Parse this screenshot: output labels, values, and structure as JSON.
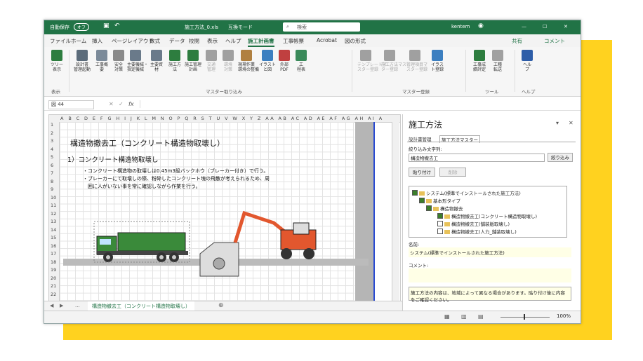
{
  "titlebar": {
    "autosave": "自動保存",
    "autosave_state": "オフ",
    "filename": "施工方法_0.xls",
    "mode": "互換モード",
    "search": "検索",
    "user": "kentem"
  },
  "tabs": [
    "ファイル",
    "ホーム",
    "挿入",
    "ページレイアウト",
    "数式",
    "データ",
    "校閲",
    "表示",
    "ヘルプ",
    "施工計画書",
    "工事帳票",
    "Acrobat",
    "図の形式"
  ],
  "active_tab": "施工計画書",
  "share": {
    "share_label": "共有",
    "comment_label": "コメント"
  },
  "ribbon": {
    "buttons": [
      {
        "label": "ツリー\n表示"
      },
      {
        "label": "設計書\n管理起動"
      },
      {
        "label": "工事概\n要"
      },
      {
        "label": "安全\n対策"
      },
      {
        "label": "主要機械・\n指定機械"
      },
      {
        "label": "主要資\n材"
      },
      {
        "label": "施工方\n法"
      },
      {
        "label": "施工管理\n計画"
      },
      {
        "label": "交通\n管理"
      },
      {
        "label": "環境\n対策"
      },
      {
        "label": "現場作業\n環境の整備"
      },
      {
        "label": "イラスト\nと図"
      },
      {
        "label": "外部\nPDF"
      },
      {
        "label": "工\n程表"
      },
      {
        "label": "テンプレートマ\nスター登録"
      },
      {
        "label": "施工方法マス\nター登録"
      },
      {
        "label": "管理項目マ\nスター登録"
      },
      {
        "label": "イラス\nト登録"
      },
      {
        "label": "工事成\n績評定"
      },
      {
        "label": "工種\n転送"
      },
      {
        "label": "ヘル\nプ"
      }
    ],
    "groups": {
      "display": "表示",
      "master_import": "マスター取り込み",
      "master_register": "マスター登録",
      "tools": "ツール",
      "help": "ヘルプ"
    }
  },
  "formula": {
    "namebox": "図 44",
    "fx": "fx"
  },
  "sheet": {
    "columns": "A B C D E F G H I J K L M N O P Q R S T U V W X Y Z AA AB AC AD AE AF AG AH AI A",
    "rows": [
      "1",
      "2",
      "3",
      "4",
      "5",
      "6",
      "7",
      "8",
      "9",
      "10",
      "11",
      "12",
      "13",
      "14",
      "15",
      "16",
      "17",
      "18",
      "19",
      "20",
      "21",
      "22"
    ],
    "title": "構造物撤去工（コンクリート構造物取壊し）",
    "subtitle": "1）コンクリート構造物取壊し",
    "line1": "・コンクリート構造物の取壊しは0.45m3級バックホウ（ブレーカー付き）で行う。",
    "line2": "・ブレーカーにて取壊しの際、粉砕したコンクリート塊の飛散が考えられるため、周",
    "line3": "　囲に人がいない事を常に確認しながら作業を行う。"
  },
  "sheet_tab": "構造物撤去工（コンクリート構造物取壊し）",
  "sheet_nav": "...",
  "pane": {
    "title": "施工方法",
    "tab1": "設計書管理",
    "tab2": "施工方法マスター",
    "filter_label": "絞り込み文字列:",
    "filter_value": "構造物撤去工",
    "filter_btn": "絞り込み",
    "paste_btn": "貼り付け",
    "delete_btn": "削除",
    "tree": [
      "システム(標準でインストールされた施工方法)",
      "基本形タイプ",
      "構造物撤去",
      "構造物撤去工(コンクリート構造物取壊し)",
      "構造物撤去工(舗装版取壊し)",
      "構造物撤去工(人力_舗装取壊し)"
    ],
    "name_label": "名前:",
    "name_value": "システム(標準でインストールされた施工方法)",
    "comment_label": "コメント:",
    "note": "施工方法の内容は、地域によって異なる場合があります。貼り付け後に内容をご確認ください。"
  },
  "status": {
    "zoom": "100%"
  }
}
